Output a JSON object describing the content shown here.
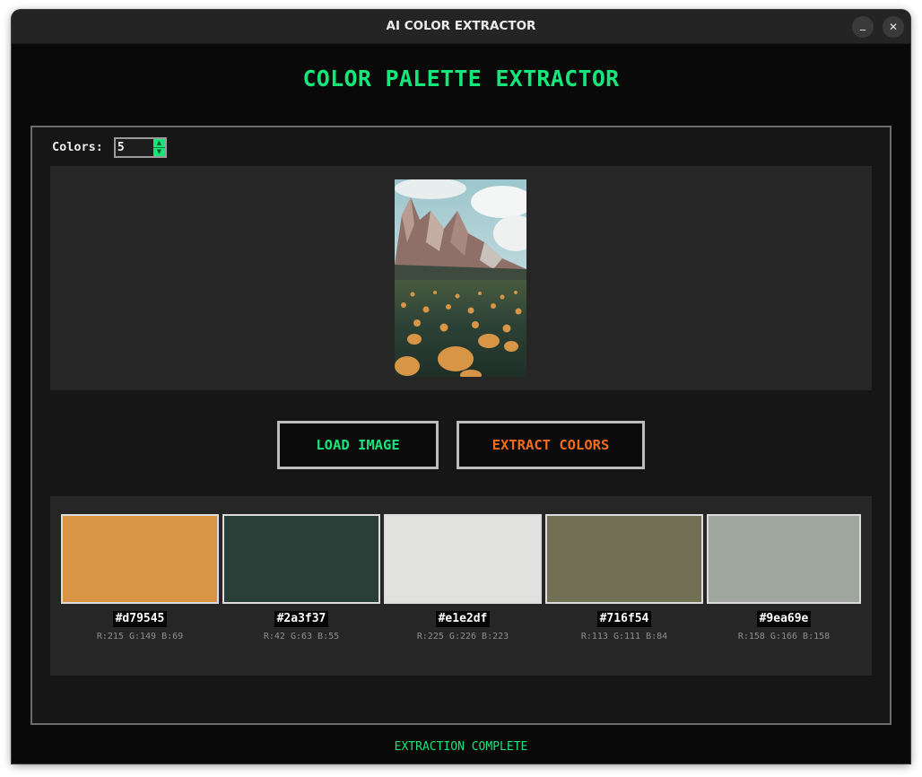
{
  "window": {
    "title": "AI COLOR EXTRACTOR",
    "minimize_icon": "minimize-icon",
    "close_icon": "close-icon"
  },
  "app": {
    "title": "COLOR PALETTE EXTRACTOR"
  },
  "controls": {
    "colors_label": "Colors:",
    "colors_value": "5"
  },
  "image": {
    "description_icon": "landscape-photo"
  },
  "buttons": {
    "load_label": "LOAD IMAGE",
    "extract_label": "EXTRACT COLORS"
  },
  "palette": [
    {
      "hex": "#d79545",
      "rgb": "R:215 G:149 B:69"
    },
    {
      "hex": "#2a3f37",
      "rgb": "R:42 G:63 B:55"
    },
    {
      "hex": "#e1e2df",
      "rgb": "R:225 G:226 B:223"
    },
    {
      "hex": "#716f54",
      "rgb": "R:113 G:111 B:84"
    },
    {
      "hex": "#9ea69e",
      "rgb": "R:158 G:166 B:158"
    }
  ],
  "status": {
    "text": "EXTRACTION COMPLETE"
  },
  "colors": {
    "accent_green": "#16e57a",
    "accent_orange": "#f26b1d",
    "background": "#090909"
  }
}
